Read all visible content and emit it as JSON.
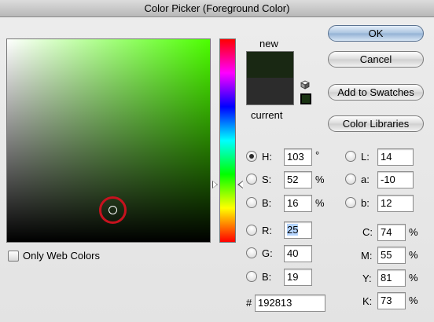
{
  "window": {
    "title": "Color Picker (Foreground Color)"
  },
  "buttons": {
    "ok": "OK",
    "cancel": "Cancel",
    "add_to_swatches": "Add to Swatches",
    "color_libraries": "Color Libraries"
  },
  "swatch": {
    "new_label": "new",
    "current_label": "current",
    "new_color": "#192813",
    "current_color": "#2c2c2c"
  },
  "only_web_colors": {
    "label": "Only Web Colors",
    "checked": false
  },
  "hsb": {
    "h": {
      "label": "H:",
      "value": "103",
      "unit": "°",
      "selected": true
    },
    "s": {
      "label": "S:",
      "value": "52",
      "unit": "%"
    },
    "b": {
      "label": "B:",
      "value": "16",
      "unit": "%"
    }
  },
  "rgb": {
    "r": {
      "label": "R:",
      "value": "25"
    },
    "g": {
      "label": "G:",
      "value": "40"
    },
    "b": {
      "label": "B:",
      "value": "19"
    }
  },
  "lab": {
    "l": {
      "label": "L:",
      "value": "14"
    },
    "a": {
      "label": "a:",
      "value": "-10"
    },
    "b": {
      "label": "b:",
      "value": "12"
    }
  },
  "cmyk": {
    "c": {
      "label": "C:",
      "value": "74",
      "unit": "%"
    },
    "m": {
      "label": "M:",
      "value": "55",
      "unit": "%"
    },
    "y": {
      "label": "Y:",
      "value": "81",
      "unit": "%"
    },
    "k": {
      "label": "K:",
      "value": "73",
      "unit": "%"
    }
  },
  "hex": {
    "label": "#",
    "value": "192813"
  }
}
